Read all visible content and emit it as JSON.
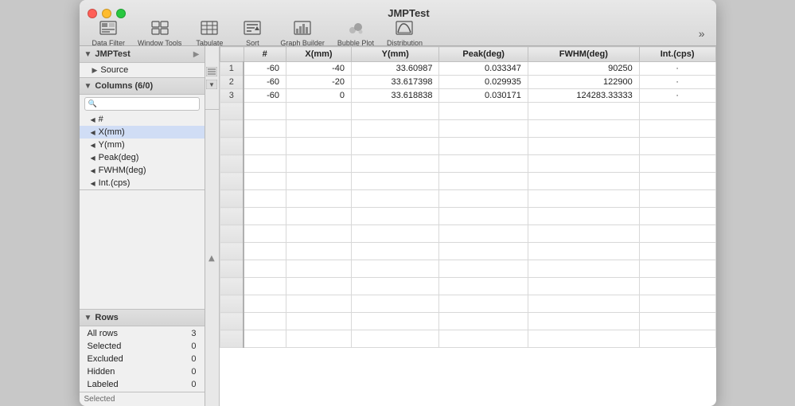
{
  "window": {
    "title": "JMPTest",
    "controls": {
      "close": "close",
      "minimize": "minimize",
      "maximize": "maximize"
    }
  },
  "toolbar": {
    "items": [
      {
        "id": "data-filter",
        "label": "Data Filter",
        "icon": "⊞"
      },
      {
        "id": "window-tools",
        "label": "Window Tools",
        "icon": "⊡"
      },
      {
        "id": "tabulate",
        "label": "Tabulate",
        "icon": "▦"
      },
      {
        "id": "sort",
        "label": "Sort",
        "icon": "↕"
      },
      {
        "id": "graph-builder",
        "label": "Graph Builder",
        "icon": "📊"
      },
      {
        "id": "bubble-plot",
        "label": "Bubble Plot",
        "icon": "⬟"
      },
      {
        "id": "distribution",
        "label": "Distribution",
        "icon": "📈"
      }
    ],
    "more_label": "»"
  },
  "sidebar": {
    "panels": {
      "jmptest": {
        "header": "JMPTest",
        "items": [
          {
            "label": "Source"
          }
        ]
      },
      "columns": {
        "header": "Columns (6/0)",
        "search_placeholder": "",
        "items": [
          {
            "label": "#"
          },
          {
            "label": "X(mm)"
          },
          {
            "label": "Y(mm)"
          },
          {
            "label": "Peak(deg)"
          },
          {
            "label": "FWHM(deg)"
          },
          {
            "label": "Int.(cps)"
          }
        ]
      },
      "rows": {
        "header": "Rows",
        "items": [
          {
            "label": "All rows",
            "value": "3"
          },
          {
            "label": "Selected",
            "value": "0"
          },
          {
            "label": "Excluded",
            "value": "0"
          },
          {
            "label": "Hidden",
            "value": "0"
          },
          {
            "label": "Labeled",
            "value": "0"
          }
        ]
      }
    }
  },
  "table": {
    "columns": [
      "#",
      "X(mm)",
      "Y(mm)",
      "Peak(deg)",
      "FWHM(deg)",
      "Int.(cps)"
    ],
    "rows": [
      {
        "row_num": "1",
        "hash": "-60",
        "x": "-40",
        "y": "33.60987",
        "peak": "0.033347",
        "fwhm": "90250",
        "int": "·"
      },
      {
        "row_num": "2",
        "hash": "-60",
        "x": "-20",
        "y": "33.617398",
        "peak": "0.029935",
        "fwhm": "122900",
        "int": "·"
      },
      {
        "row_num": "3",
        "hash": "-60",
        "x": "0",
        "y": "33.618838",
        "peak": "0.030171",
        "fwhm": "124283.33333",
        "int": "·"
      }
    ]
  },
  "status": {
    "selected_label": "Selected"
  }
}
